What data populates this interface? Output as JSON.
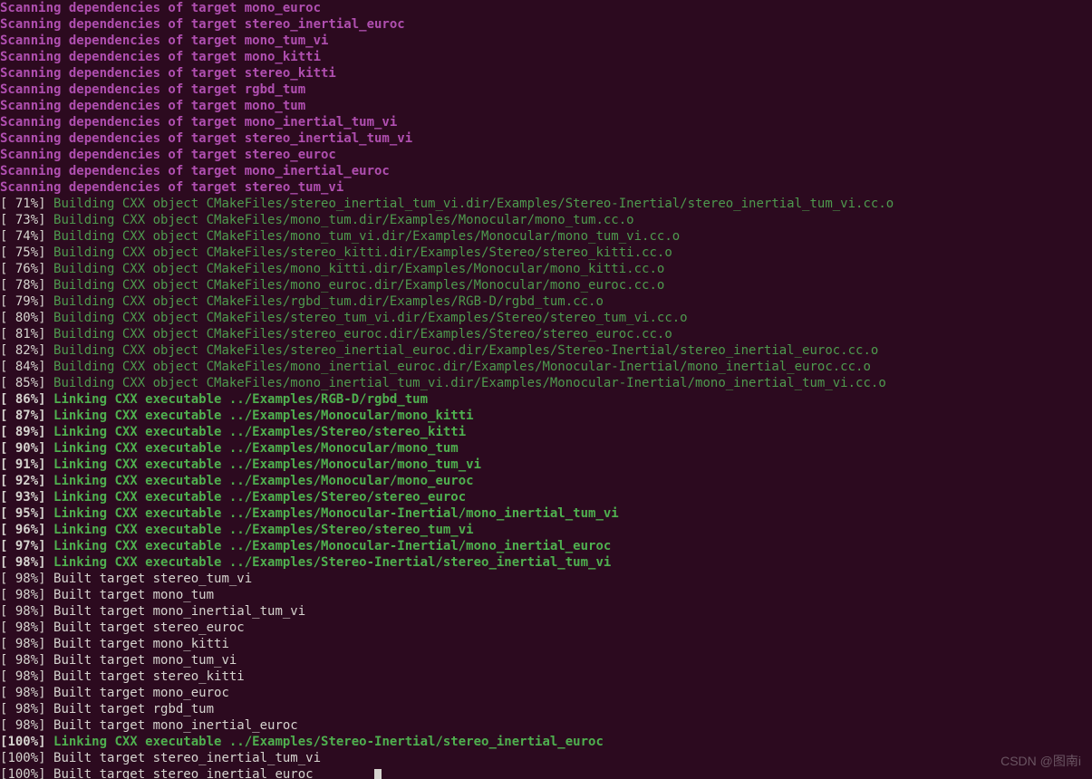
{
  "watermark": "CSDN @图南i",
  "lines": [
    {
      "type": "scan",
      "text": "Scanning dependencies of target mono_euroc"
    },
    {
      "type": "scan",
      "text": "Scanning dependencies of target stereo_inertial_euroc"
    },
    {
      "type": "scan",
      "text": "Scanning dependencies of target mono_tum_vi"
    },
    {
      "type": "scan",
      "text": "Scanning dependencies of target mono_kitti"
    },
    {
      "type": "scan",
      "text": "Scanning dependencies of target stereo_kitti"
    },
    {
      "type": "scan",
      "text": "Scanning dependencies of target rgbd_tum"
    },
    {
      "type": "scan",
      "text": "Scanning dependencies of target mono_tum"
    },
    {
      "type": "scan",
      "text": "Scanning dependencies of target mono_inertial_tum_vi"
    },
    {
      "type": "scan",
      "text": "Scanning dependencies of target stereo_inertial_tum_vi"
    },
    {
      "type": "scan",
      "text": "Scanning dependencies of target stereo_euroc"
    },
    {
      "type": "scan",
      "text": "Scanning dependencies of target mono_inertial_euroc"
    },
    {
      "type": "scan",
      "text": "Scanning dependencies of target stereo_tum_vi"
    },
    {
      "type": "build",
      "percent": " 71%",
      "text": "Building CXX object CMakeFiles/stereo_inertial_tum_vi.dir/Examples/Stereo-Inertial/stereo_inertial_tum_vi.cc.o"
    },
    {
      "type": "build",
      "percent": " 73%",
      "text": "Building CXX object CMakeFiles/mono_tum.dir/Examples/Monocular/mono_tum.cc.o"
    },
    {
      "type": "build",
      "percent": " 74%",
      "text": "Building CXX object CMakeFiles/mono_tum_vi.dir/Examples/Monocular/mono_tum_vi.cc.o"
    },
    {
      "type": "build",
      "percent": " 75%",
      "text": "Building CXX object CMakeFiles/stereo_kitti.dir/Examples/Stereo/stereo_kitti.cc.o"
    },
    {
      "type": "build",
      "percent": " 76%",
      "text": "Building CXX object CMakeFiles/mono_kitti.dir/Examples/Monocular/mono_kitti.cc.o"
    },
    {
      "type": "build",
      "percent": " 78%",
      "text": "Building CXX object CMakeFiles/mono_euroc.dir/Examples/Monocular/mono_euroc.cc.o"
    },
    {
      "type": "build",
      "percent": " 79%",
      "text": "Building CXX object CMakeFiles/rgbd_tum.dir/Examples/RGB-D/rgbd_tum.cc.o"
    },
    {
      "type": "build",
      "percent": " 80%",
      "text": "Building CXX object CMakeFiles/stereo_tum_vi.dir/Examples/Stereo/stereo_tum_vi.cc.o"
    },
    {
      "type": "build",
      "percent": " 81%",
      "text": "Building CXX object CMakeFiles/stereo_euroc.dir/Examples/Stereo/stereo_euroc.cc.o"
    },
    {
      "type": "build",
      "percent": " 82%",
      "text": "Building CXX object CMakeFiles/stereo_inertial_euroc.dir/Examples/Stereo-Inertial/stereo_inertial_euroc.cc.o"
    },
    {
      "type": "build",
      "percent": " 84%",
      "text": "Building CXX object CMakeFiles/mono_inertial_euroc.dir/Examples/Monocular-Inertial/mono_inertial_euroc.cc.o"
    },
    {
      "type": "build",
      "percent": " 85%",
      "text": "Building CXX object CMakeFiles/mono_inertial_tum_vi.dir/Examples/Monocular-Inertial/mono_inertial_tum_vi.cc.o"
    },
    {
      "type": "link",
      "percent": " 86%",
      "text": "Linking CXX executable ../Examples/RGB-D/rgbd_tum"
    },
    {
      "type": "link",
      "percent": " 87%",
      "text": "Linking CXX executable ../Examples/Monocular/mono_kitti"
    },
    {
      "type": "link",
      "percent": " 89%",
      "text": "Linking CXX executable ../Examples/Stereo/stereo_kitti"
    },
    {
      "type": "link",
      "percent": " 90%",
      "text": "Linking CXX executable ../Examples/Monocular/mono_tum"
    },
    {
      "type": "link",
      "percent": " 91%",
      "text": "Linking CXX executable ../Examples/Monocular/mono_tum_vi"
    },
    {
      "type": "link",
      "percent": " 92%",
      "text": "Linking CXX executable ../Examples/Monocular/mono_euroc"
    },
    {
      "type": "link",
      "percent": " 93%",
      "text": "Linking CXX executable ../Examples/Stereo/stereo_euroc"
    },
    {
      "type": "link",
      "percent": " 95%",
      "text": "Linking CXX executable ../Examples/Monocular-Inertial/mono_inertial_tum_vi"
    },
    {
      "type": "link",
      "percent": " 96%",
      "text": "Linking CXX executable ../Examples/Stereo/stereo_tum_vi"
    },
    {
      "type": "link",
      "percent": " 97%",
      "text": "Linking CXX executable ../Examples/Monocular-Inertial/mono_inertial_euroc"
    },
    {
      "type": "link",
      "percent": " 98%",
      "text": "Linking CXX executable ../Examples/Stereo-Inertial/stereo_inertial_tum_vi"
    },
    {
      "type": "built",
      "percent": " 98%",
      "text": "Built target stereo_tum_vi"
    },
    {
      "type": "built",
      "percent": " 98%",
      "text": "Built target mono_tum"
    },
    {
      "type": "built",
      "percent": " 98%",
      "text": "Built target mono_inertial_tum_vi"
    },
    {
      "type": "built",
      "percent": " 98%",
      "text": "Built target stereo_euroc"
    },
    {
      "type": "built",
      "percent": " 98%",
      "text": "Built target mono_kitti"
    },
    {
      "type": "built",
      "percent": " 98%",
      "text": "Built target mono_tum_vi"
    },
    {
      "type": "built",
      "percent": " 98%",
      "text": "Built target stereo_kitti"
    },
    {
      "type": "built",
      "percent": " 98%",
      "text": "Built target mono_euroc"
    },
    {
      "type": "built",
      "percent": " 98%",
      "text": "Built target rgbd_tum"
    },
    {
      "type": "built",
      "percent": " 98%",
      "text": "Built target mono_inertial_euroc"
    },
    {
      "type": "link",
      "percent": "100%",
      "text": "Linking CXX executable ../Examples/Stereo-Inertial/stereo_inertial_euroc"
    },
    {
      "type": "built",
      "percent": "100%",
      "text": "Built target stereo_inertial_tum_vi"
    },
    {
      "type": "built-cursor",
      "percent": "100%",
      "text": "Built target stereo_inertial_euroc"
    }
  ]
}
